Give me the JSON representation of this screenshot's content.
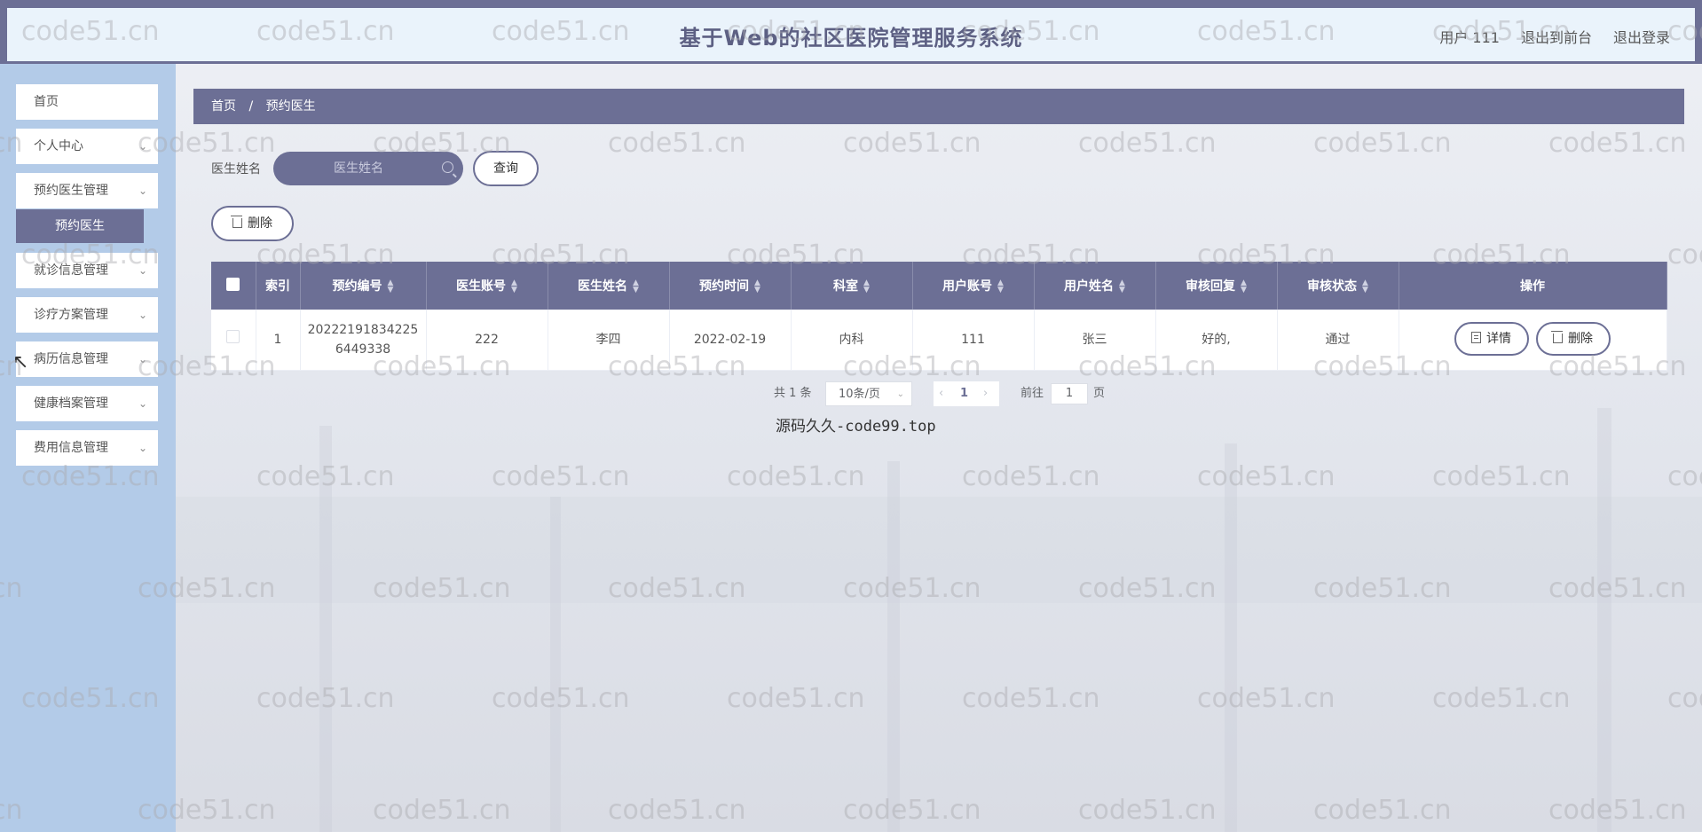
{
  "header": {
    "title": "基于Web的社区医院管理服务系统",
    "user": "用户 111",
    "back_to_front": "退出到前台",
    "logout": "退出登录"
  },
  "sidebar": {
    "items": [
      {
        "label": "首页"
      },
      {
        "label": "个人中心"
      },
      {
        "label": "预约医生管理"
      },
      {
        "label": "就诊信息管理"
      },
      {
        "label": "诊疗方案管理"
      },
      {
        "label": "病历信息管理"
      },
      {
        "label": "健康档案管理"
      },
      {
        "label": "费用信息管理"
      }
    ],
    "active_sub": "预约医生"
  },
  "breadcrumb": {
    "home": "首页",
    "sep": "/",
    "current": "预约医生"
  },
  "search": {
    "label": "医生姓名",
    "placeholder": "医生姓名",
    "query_button": "查询"
  },
  "toolbar": {
    "delete_button": "删除"
  },
  "table": {
    "headers": [
      "",
      "索引",
      "预约编号",
      "医生账号",
      "医生姓名",
      "预约时间",
      "科室",
      "用户账号",
      "用户姓名",
      "审核回复",
      "审核状态",
      "操作"
    ],
    "rows": [
      {
        "index": "1",
        "booking_no_1": "20222191834225",
        "booking_no_2": "6449338",
        "doctor_account": "222",
        "doctor_name": "李四",
        "time": "2022-02-19",
        "department": "内科",
        "user_account": "111",
        "user_name": "张三",
        "reply": "好的,",
        "status": "通过",
        "detail_button": "详情",
        "delete_button": "删除"
      }
    ]
  },
  "pagination": {
    "total": "共 1 条",
    "page_size": "10条/页",
    "current_page": "1",
    "goto_label": "前往",
    "goto_value": "1",
    "page_suffix": "页"
  },
  "footer_note": "源码久久-code99.top",
  "watermark": "code51.cn",
  "colors": {
    "primary": "#6c6f95",
    "sidebar": "#b3cbe8",
    "header_bg": "#eaf3fb"
  }
}
